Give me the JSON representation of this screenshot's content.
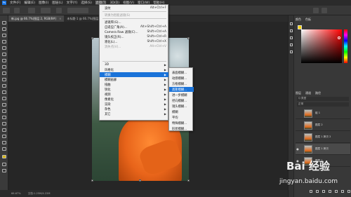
{
  "menubar": {
    "logo": "Ps",
    "items": [
      "文件(F)",
      "编辑(E)",
      "图像(I)",
      "图层(L)",
      "文字(Y)",
      "选择(S)",
      "滤镜(T)",
      "3D(D)",
      "视图(V)",
      "窗口(W)",
      "帮助(H)"
    ],
    "active_index": 6
  },
  "tabs": [
    {
      "label": "新.jpg @ 66.7%(图层 2, RGB/8#)",
      "close": "×"
    },
    {
      "label": "未标题-1 @ 66.7%(图层 1 拷贝 2, RGB/8#)",
      "close": "×"
    }
  ],
  "filter_menu": {
    "items": [
      {
        "label": "波纹",
        "shortcut": "Alt+Ctrl+F",
        "disabled": false
      },
      {
        "label": "转换为智能滤镜(S)",
        "shortcut": "",
        "disabled": true
      },
      {
        "label": "滤镜库(G)...",
        "shortcut": "",
        "disabled": false
      },
      {
        "label": "自适应广角(A)...",
        "shortcut": "Alt+Shift+Ctrl+A",
        "disabled": false
      },
      {
        "label": "Camera Raw 滤镜(C)...",
        "shortcut": "Shift+Ctrl+A",
        "disabled": false
      },
      {
        "label": "镜头校正(R)...",
        "shortcut": "Shift+Ctrl+R",
        "disabled": false
      },
      {
        "label": "液化(L)...",
        "shortcut": "Shift+Ctrl+X",
        "disabled": false
      },
      {
        "label": "消失点(V)...",
        "shortcut": "Alt+Ctrl+V",
        "disabled": true
      },
      {
        "label": "3D",
        "submenu": true
      },
      {
        "label": "风格化",
        "submenu": true
      },
      {
        "label": "模糊",
        "submenu": true,
        "highlighted": true
      },
      {
        "label": "模糊画廊",
        "submenu": true
      },
      {
        "label": "扭曲",
        "submenu": true
      },
      {
        "label": "锐化",
        "submenu": true
      },
      {
        "label": "视频",
        "submenu": true
      },
      {
        "label": "像素化",
        "submenu": true
      },
      {
        "label": "渲染",
        "submenu": true
      },
      {
        "label": "杂色",
        "submenu": true
      },
      {
        "label": "其它",
        "submenu": true
      }
    ],
    "arrow": "▶"
  },
  "blur_submenu": {
    "items": [
      "表面模糊...",
      "动感模糊...",
      "方框模糊...",
      "高斯模糊...",
      "进一步模糊",
      "径向模糊...",
      "镜头模糊...",
      "模糊",
      "平均",
      "特殊模糊...",
      "形状模糊..."
    ],
    "highlighted_index": 3
  },
  "status": {
    "zoom": "66.67%",
    "doc": "文档:1.25M/4.22M"
  },
  "right_panel": {
    "tabs": [
      "颜色",
      "色板"
    ],
    "layers_tabs": [
      "图层",
      "通道",
      "路径"
    ],
    "filter_label": "Q 类型",
    "mode_label": "正常",
    "layers": [
      {
        "name": "组 1",
        "visible": false,
        "selected": false
      },
      {
        "name": "图层 2",
        "visible": false,
        "selected": false
      },
      {
        "name": "图层 1 拷贝 2",
        "visible": false,
        "selected": false
      },
      {
        "name": "图层 1 拷贝",
        "visible": true,
        "selected": true
      },
      {
        "name": "图层 1",
        "visible": true,
        "selected": false
      }
    ],
    "eye_glyph": "●"
  },
  "colors": {
    "foreground": "#ffd400",
    "background": "#ffffff",
    "highlight": "#1a73d9",
    "jacket": "#e8641a"
  },
  "watermark": {
    "main": "Bai 经验",
    "url": "jingyan.baidu.com"
  }
}
